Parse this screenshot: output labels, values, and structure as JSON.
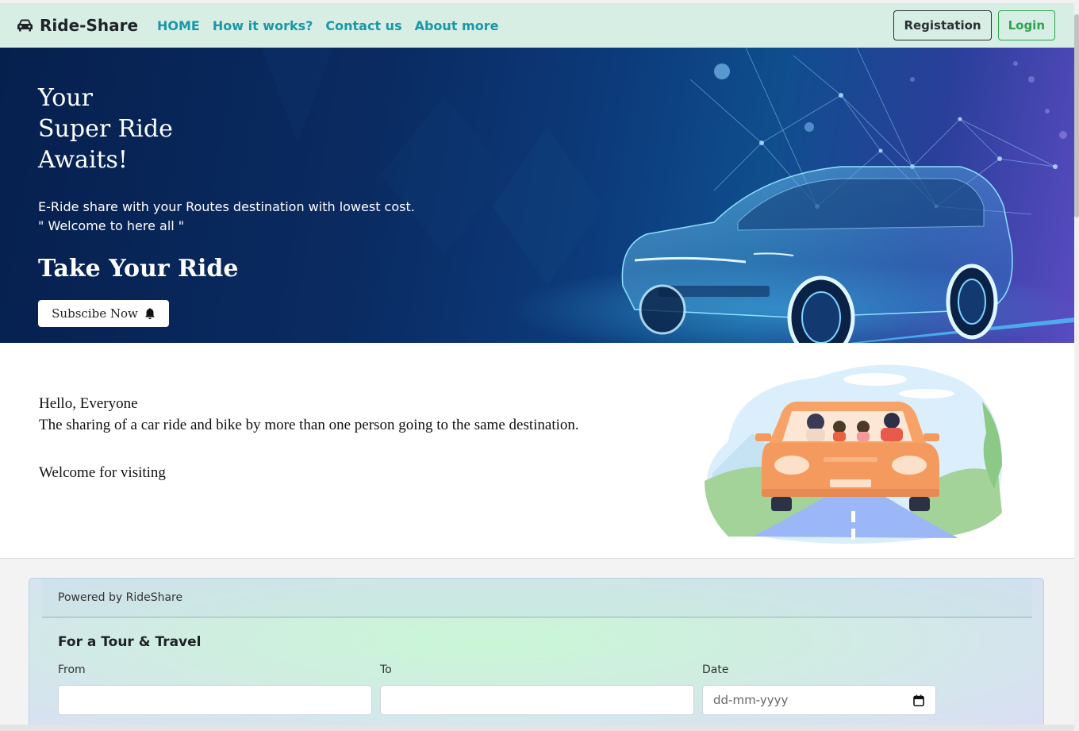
{
  "navbar": {
    "brand": "Ride-Share",
    "brand_icon": "car-icon",
    "links": [
      "HOME",
      "How it works?",
      "Contact us",
      "About more"
    ],
    "registration_label": "Registation",
    "login_label": "Login",
    "colors": {
      "background": "#d6eee4",
      "link": "#1a97a6",
      "login": "#2ea44f"
    }
  },
  "hero": {
    "title_line1": "Your",
    "title_line2": "Super Ride",
    "title_line3": "Awaits!",
    "subtitle_line1": "E-Ride share with your Routes destination with lowest cost.",
    "subtitle_line2": "\" Welcome to here all \"",
    "cta_title": "Take Your Ride",
    "subscribe_label": "Subscibe Now",
    "subscribe_icon": "bell-icon"
  },
  "welcome": {
    "greeting": "Hello, Everyone",
    "description": "The sharing of a car ride and bike by more than one person going to the same destination.",
    "visit": "Welcome for visiting"
  },
  "booking": {
    "powered_by": "Powered by RideShare",
    "title": "For a Tour & Travel",
    "from_label": "From",
    "to_label": "To",
    "date_label": "Date",
    "date_placeholder": "dd-mm-yyyy",
    "calendar_icon": "calendar-icon"
  }
}
